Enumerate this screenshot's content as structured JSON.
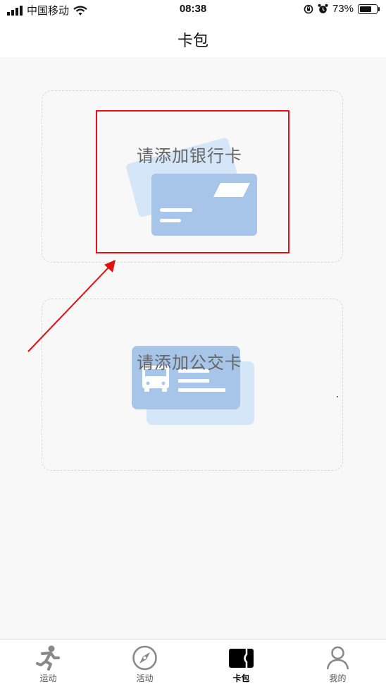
{
  "status_bar": {
    "carrier": "中国移动",
    "time": "08:38",
    "battery_percent": "73%",
    "battery_level": 0.73,
    "icons": [
      "signal-icon",
      "wifi-icon",
      "rotation-lock-icon",
      "alarm-icon",
      "battery-icon"
    ]
  },
  "nav": {
    "title": "卡包"
  },
  "cards": {
    "bank": {
      "label": "请添加银行卡",
      "icon": "bank-card-icon"
    },
    "transit": {
      "label": "请添加公交卡",
      "icon": "bus-card-icon"
    }
  },
  "tabs": [
    {
      "label": "运动",
      "icon": "running-icon",
      "active": false
    },
    {
      "label": "活动",
      "icon": "compass-icon",
      "active": false
    },
    {
      "label": "卡包",
      "icon": "wallet-icon",
      "active": true
    },
    {
      "label": "我的",
      "icon": "user-icon",
      "active": false
    }
  ],
  "annotation": {
    "color": "#e11111"
  },
  "colors": {
    "card_blue": "#a6c5e8",
    "card_light_blue": "#d5e6f8",
    "tab_gray": "#777777"
  }
}
